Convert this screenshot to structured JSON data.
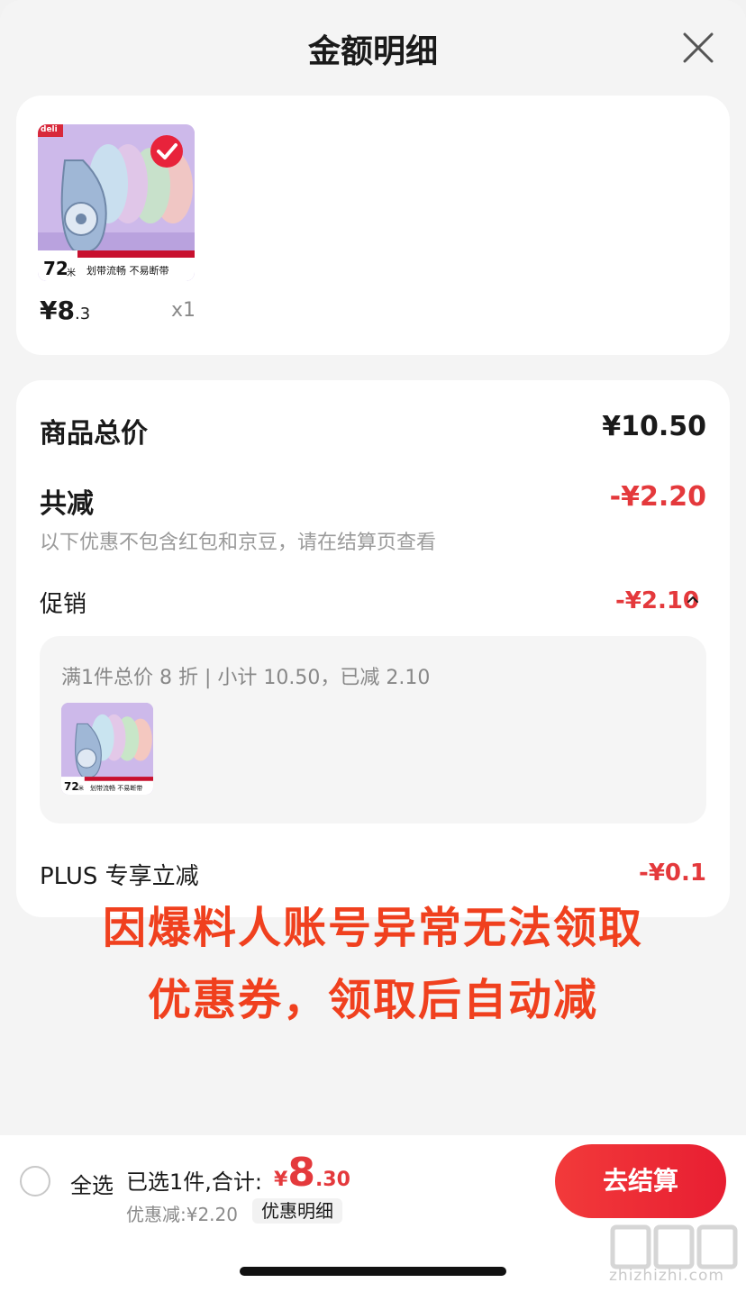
{
  "header": {
    "title": "金额明细"
  },
  "product": {
    "price_symbol": "¥",
    "price_int": "8",
    "price_dec": ".3",
    "quantity": "x1",
    "image_badge_number": "72",
    "image_badge_unit": "米",
    "image_caption": "划带流畅 不易断带",
    "image_brand": "deli"
  },
  "summary": {
    "total_label": "商品总价",
    "total_value": "¥10.50",
    "reduce_label": "共减",
    "reduce_value": "-¥2.20",
    "reduce_note": "以下优惠不包含红包和京豆，请在结算页查看",
    "promo_label": "促销",
    "promo_value": "-¥2.10",
    "promo_desc": "满1件总价 8 折 | 小计 10.50，已减 2.10",
    "plus_label": "PLUS 专享立减",
    "plus_value": "-¥0.1"
  },
  "overlay": {
    "line1": "因爆料人账号异常无法领取",
    "line2": "优惠券，领取后自动减"
  },
  "bottom_bar": {
    "select_all": "全选",
    "selected_summary": "已选1件,合计:",
    "total_symbol": "¥",
    "total_int": "8",
    "total_dec": ".30",
    "discount_text": "优惠减:¥2.20",
    "detail_button": "优惠明细",
    "checkout_button": "去结算"
  },
  "watermark": {
    "site": "zhizhizhi.com"
  },
  "colors": {
    "accent_red": "#e4393c",
    "overlay_red": "#f0401e"
  }
}
